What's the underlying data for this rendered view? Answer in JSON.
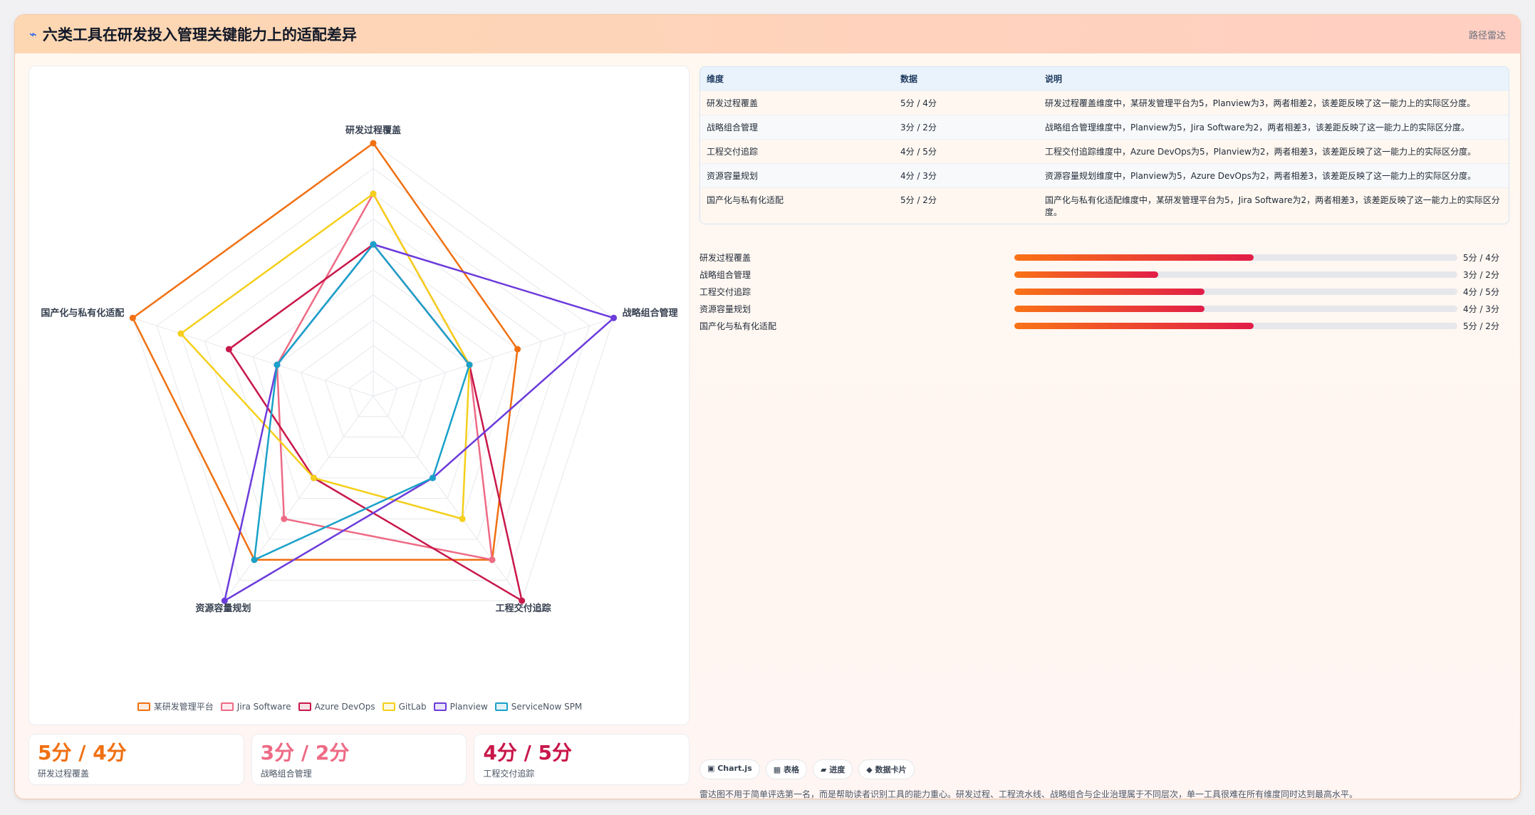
{
  "header": {
    "icon": "pulse-icon",
    "title": "六类工具在研发投入管理关键能力上的适配差异",
    "tag": "路径雷达"
  },
  "chart_data": {
    "type": "radar",
    "axes": [
      "研发过程覆盖",
      "战略组合管理",
      "工程交付追踪",
      "资源容量规划",
      "国产化与私有化适配"
    ],
    "max": 5,
    "levels": 10,
    "series": [
      {
        "name": "某研发管理平台",
        "color": "#f07012",
        "values": [
          5,
          3,
          4,
          4,
          5
        ]
      },
      {
        "name": "Jira Software",
        "color": "#ee6b85",
        "values": [
          4,
          2,
          4,
          3,
          2
        ]
      },
      {
        "name": "Azure DevOps",
        "color": "#c8174a",
        "values": [
          3,
          2,
          5,
          2,
          3
        ]
      },
      {
        "name": "GitLab",
        "color": "#f5cf1b",
        "values": [
          4,
          2,
          3,
          2,
          4
        ]
      },
      {
        "name": "Planview",
        "color": "#6c3bdb",
        "values": [
          3,
          5,
          2,
          5,
          2
        ]
      },
      {
        "name": "ServiceNow SPM",
        "color": "#19a1c9",
        "values": [
          3,
          2,
          2,
          4,
          2
        ]
      }
    ]
  },
  "stats": [
    {
      "value": "5分 / 4分",
      "label": "研发过程覆盖",
      "color": "#f07012"
    },
    {
      "value": "3分 / 2分",
      "label": "战略组合管理",
      "color": "#ee6b85"
    },
    {
      "value": "4分 / 5分",
      "label": "工程交付追踪",
      "color": "#c8174a"
    }
  ],
  "table": {
    "headers": [
      "维度",
      "数据",
      "说明"
    ],
    "rows": [
      [
        "研发过程覆盖",
        "5分 / 4分",
        "研发过程覆盖维度中，某研发管理平台为5，Planview为3，两者相差2，该差距反映了这一能力上的实际区分度。"
      ],
      [
        "战略组合管理",
        "3分 / 2分",
        "战略组合管理维度中，Planview为5，Jira Software为2，两者相差3，该差距反映了这一能力上的实际区分度。"
      ],
      [
        "工程交付追踪",
        "4分 / 5分",
        "工程交付追踪维度中，Azure DevOps为5，Planview为2，两者相差3，该差距反映了这一能力上的实际区分度。"
      ],
      [
        "资源容量规划",
        "4分 / 3分",
        "资源容量规划维度中，Planview为5，Azure DevOps为2，两者相差3，该差距反映了这一能力上的实际区分度。"
      ],
      [
        "国产化与私有化适配",
        "5分 / 2分",
        "国产化与私有化适配维度中，某研发管理平台为5，Jira Software为2，两者相差3，该差距反映了这一能力上的实际区分度。"
      ]
    ]
  },
  "progress": [
    {
      "label": "研发过程覆盖",
      "value": "5分 / 4分",
      "fraction": 0.54
    },
    {
      "label": "战略组合管理",
      "value": "3分 / 2分",
      "fraction": 0.325
    },
    {
      "label": "工程交付追踪",
      "value": "4分 / 5分",
      "fraction": 0.43
    },
    {
      "label": "资源容量规划",
      "value": "4分 / 3分",
      "fraction": 0.43
    },
    {
      "label": "国产化与私有化适配",
      "value": "5分 / 2分",
      "fraction": 0.54
    }
  ],
  "chips": [
    {
      "icon": "▣",
      "label": "Chart.js"
    },
    {
      "icon": "▦",
      "label": "表格"
    },
    {
      "icon": "▰",
      "label": "进度"
    },
    {
      "icon": "◆",
      "label": "数据卡片"
    }
  ],
  "footnote": "雷达图不用于简单评选第一名，而是帮助读者识别工具的能力重心。研发过程、工程流水线、战略组合与企业治理属于不同层次，单一工具很难在所有维度同时达到最高水平。"
}
